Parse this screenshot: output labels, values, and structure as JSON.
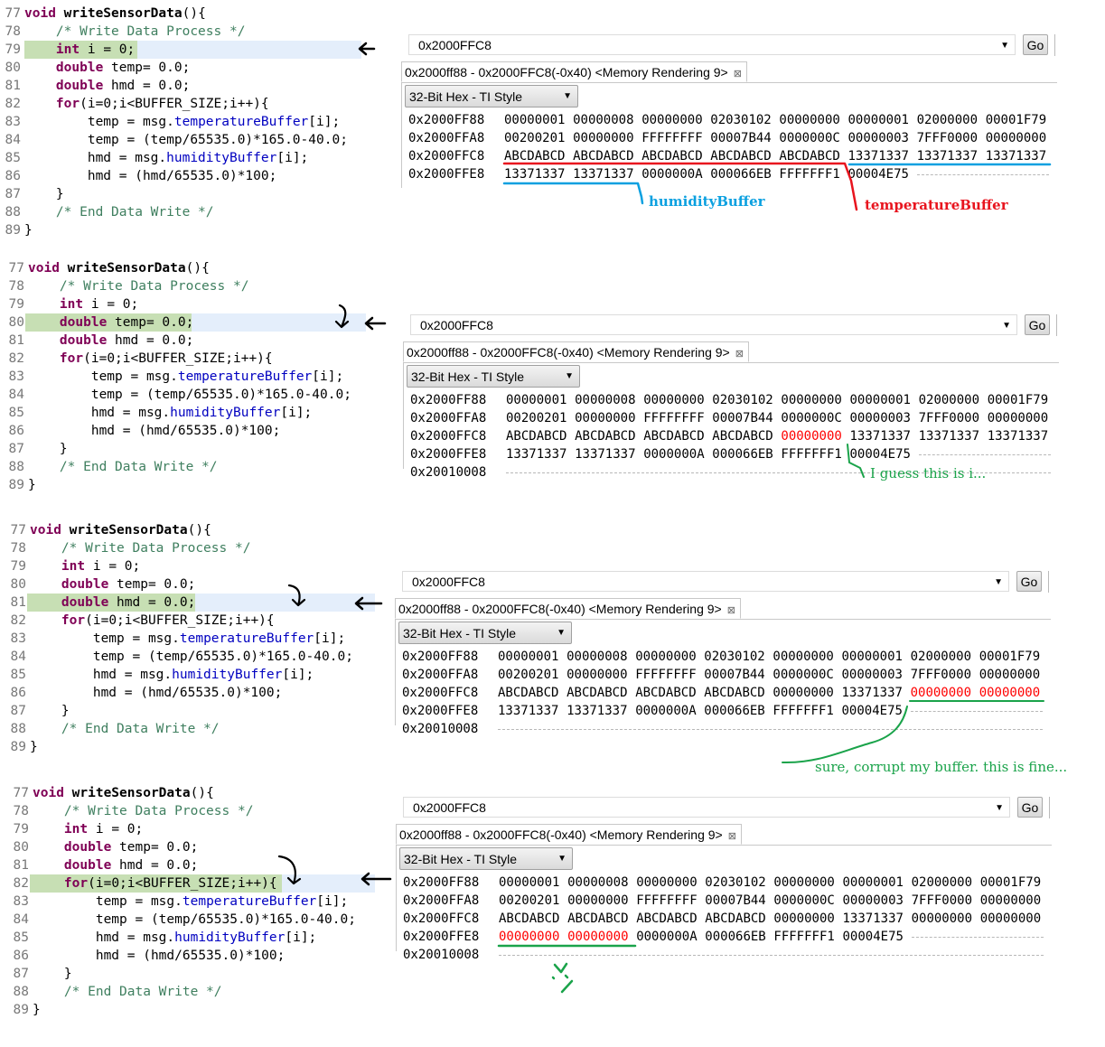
{
  "code": {
    "lines": [
      {
        "num": "77",
        "tokens": [
          [
            "void",
            "keyword"
          ],
          [
            " ",
            "plain"
          ],
          [
            "writeSensorData",
            "function"
          ],
          [
            "(){",
            "plain"
          ]
        ]
      },
      {
        "num": "78",
        "tokens": [
          [
            "    ",
            "plain"
          ],
          [
            "/* Write Data Process */",
            "comment"
          ]
        ]
      },
      {
        "num": "79",
        "tokens": [
          [
            "    ",
            "plain"
          ],
          [
            "int",
            "keyword"
          ],
          [
            " i = 0;",
            "plain"
          ]
        ]
      },
      {
        "num": "80",
        "tokens": [
          [
            "    ",
            "plain"
          ],
          [
            "double",
            "keyword"
          ],
          [
            " temp= 0.0;",
            "plain"
          ]
        ]
      },
      {
        "num": "81",
        "tokens": [
          [
            "    ",
            "plain"
          ],
          [
            "double",
            "keyword"
          ],
          [
            " hmd = 0.0;",
            "plain"
          ]
        ]
      },
      {
        "num": "82",
        "tokens": [
          [
            "    ",
            "plain"
          ],
          [
            "for",
            "keyword"
          ],
          [
            "(i=0;i<BUFFER_SIZE;i++){",
            "plain"
          ]
        ]
      },
      {
        "num": "83",
        "tokens": [
          [
            "        temp = msg.",
            "plain"
          ],
          [
            "temperatureBuffer",
            "field"
          ],
          [
            "[i];",
            "plain"
          ]
        ]
      },
      {
        "num": "84",
        "tokens": [
          [
            "        temp = (temp/65535.0)*165.0-40.0;",
            "plain"
          ]
        ]
      },
      {
        "num": "85",
        "tokens": [
          [
            "        hmd = msg.",
            "plain"
          ],
          [
            "humidityBuffer",
            "field"
          ],
          [
            "[i];",
            "plain"
          ]
        ]
      },
      {
        "num": "86",
        "tokens": [
          [
            "        hmd = (hmd/65535.0)*100;",
            "plain"
          ]
        ]
      },
      {
        "num": "87",
        "tokens": [
          [
            "    }",
            "plain"
          ]
        ]
      },
      {
        "num": "88",
        "tokens": [
          [
            "    ",
            "plain"
          ],
          [
            "/* End Data Write */",
            "comment"
          ]
        ]
      },
      {
        "num": "89",
        "tokens": [
          [
            "}",
            "plain"
          ]
        ]
      }
    ]
  },
  "memory_view": {
    "address": "0x2000FFC8",
    "go_label": "Go",
    "tab_label": "0x2000ff88 - 0x2000FFC8(-0x40) <Memory Rendering 9>",
    "format": "32-Bit Hex - TI Style"
  },
  "colors": {
    "red_value": "#ff0000",
    "keyword": "#7f0055",
    "comment": "#3f7f5f",
    "field": "#0000c0",
    "annotation_green": "#1aa34a",
    "annotation_blue": "#0aa0e0",
    "annotation_red": "#e8141e"
  },
  "panels": [
    {
      "current_line": "79",
      "rows": [
        {
          "addr": "0x2000FF88",
          "cells": [
            "00000001",
            "00000008",
            "00000000",
            "02030102",
            "00000000",
            "00000001",
            "02000000",
            "00001F79"
          ],
          "red": []
        },
        {
          "addr": "0x2000FFA8",
          "cells": [
            "00200201",
            "00000000",
            "FFFFFFFF",
            "00007B44",
            "0000000C",
            "00000003",
            "7FFF0000",
            "00000000"
          ],
          "red": []
        },
        {
          "addr": "0x2000FFC8",
          "cells": [
            "ABCDABCD",
            "ABCDABCD",
            "ABCDABCD",
            "ABCDABCD",
            "ABCDABCD",
            "13371337",
            "13371337",
            "13371337"
          ],
          "red": []
        },
        {
          "addr": "0x2000FFE8",
          "cells": [
            "13371337",
            "13371337",
            "0000000A",
            "000066EB",
            "FFFFFFF1",
            "00004E75"
          ],
          "red": []
        }
      ],
      "annotations": [
        {
          "text": "humidityBuffer",
          "color": "#0aa0e0"
        },
        {
          "text": "temperatureBuffer",
          "color": "#e8141e"
        }
      ]
    },
    {
      "current_line": "80",
      "rows": [
        {
          "addr": "0x2000FF88",
          "cells": [
            "00000001",
            "00000008",
            "00000000",
            "02030102",
            "00000000",
            "00000001",
            "02000000",
            "00001F79"
          ],
          "red": []
        },
        {
          "addr": "0x2000FFA8",
          "cells": [
            "00200201",
            "00000000",
            "FFFFFFFF",
            "00007B44",
            "0000000C",
            "00000003",
            "7FFF0000",
            "00000000"
          ],
          "red": []
        },
        {
          "addr": "0x2000FFC8",
          "cells": [
            "ABCDABCD",
            "ABCDABCD",
            "ABCDABCD",
            "ABCDABCD",
            "00000000",
            "13371337",
            "13371337",
            "13371337"
          ],
          "red": [
            4
          ]
        },
        {
          "addr": "0x2000FFE8",
          "cells": [
            "13371337",
            "13371337",
            "0000000A",
            "000066EB",
            "FFFFFFF1",
            "00004E75"
          ],
          "red": []
        },
        {
          "addr": "0x20010008",
          "cells": [],
          "red": []
        }
      ],
      "annotations": [
        {
          "text": "I guess this is i...",
          "color": "#1aa34a"
        }
      ]
    },
    {
      "current_line": "81",
      "rows": [
        {
          "addr": "0x2000FF88",
          "cells": [
            "00000001",
            "00000008",
            "00000000",
            "02030102",
            "00000000",
            "00000001",
            "02000000",
            "00001F79"
          ],
          "red": []
        },
        {
          "addr": "0x2000FFA8",
          "cells": [
            "00200201",
            "00000000",
            "FFFFFFFF",
            "00007B44",
            "0000000C",
            "00000003",
            "7FFF0000",
            "00000000"
          ],
          "red": []
        },
        {
          "addr": "0x2000FFC8",
          "cells": [
            "ABCDABCD",
            "ABCDABCD",
            "ABCDABCD",
            "ABCDABCD",
            "00000000",
            "13371337",
            "00000000",
            "00000000"
          ],
          "red": [
            6,
            7
          ]
        },
        {
          "addr": "0x2000FFE8",
          "cells": [
            "13371337",
            "13371337",
            "0000000A",
            "000066EB",
            "FFFFFFF1",
            "00004E75"
          ],
          "red": []
        },
        {
          "addr": "0x20010008",
          "cells": [],
          "red": []
        }
      ],
      "annotations": [
        {
          "text": "sure, corrupt my buffer. this is fine...",
          "color": "#1aa34a"
        }
      ]
    },
    {
      "current_line": "82",
      "rows": [
        {
          "addr": "0x2000FF88",
          "cells": [
            "00000001",
            "00000008",
            "00000000",
            "02030102",
            "00000000",
            "00000001",
            "02000000",
            "00001F79"
          ],
          "red": []
        },
        {
          "addr": "0x2000FFA8",
          "cells": [
            "00200201",
            "00000000",
            "FFFFFFFF",
            "00007B44",
            "0000000C",
            "00000003",
            "7FFF0000",
            "00000000"
          ],
          "red": []
        },
        {
          "addr": "0x2000FFC8",
          "cells": [
            "ABCDABCD",
            "ABCDABCD",
            "ABCDABCD",
            "ABCDABCD",
            "00000000",
            "13371337",
            "00000000",
            "00000000"
          ],
          "red": []
        },
        {
          "addr": "0x2000FFE8",
          "cells": [
            "00000000",
            "00000000",
            "0000000A",
            "000066EB",
            "FFFFFFF1",
            "00004E75"
          ],
          "red": [
            0,
            1
          ]
        },
        {
          "addr": "0x20010008",
          "cells": [],
          "red": []
        }
      ],
      "annotations": []
    }
  ]
}
